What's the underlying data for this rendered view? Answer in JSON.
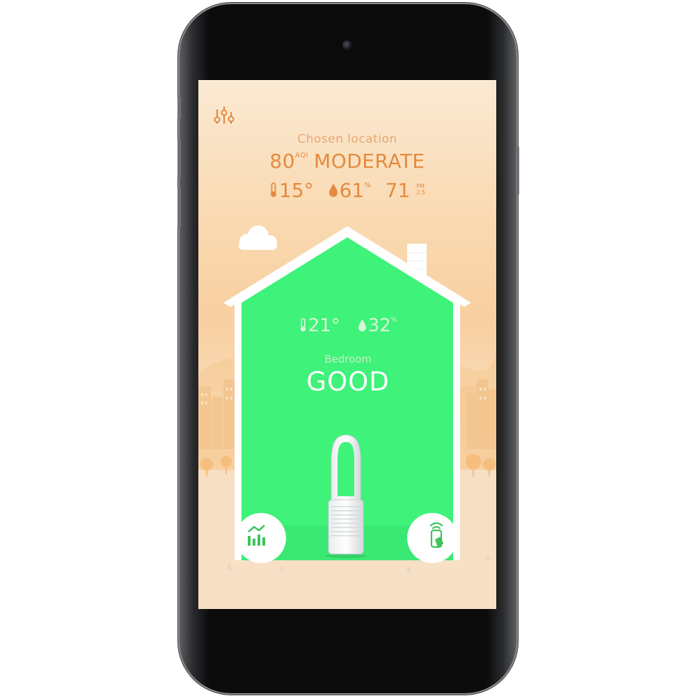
{
  "outdoor": {
    "location_label": "Chosen location",
    "aqi_value": "80",
    "aqi_unit": "AQI",
    "aqi_status": "MODERATE",
    "temperature": "15°",
    "humidity": "61",
    "humidity_unit": "%",
    "pm_value": "71",
    "pm_unit_top": "PM",
    "pm_unit_bottom": "2.5"
  },
  "indoor": {
    "temperature": "21°",
    "humidity": "32",
    "humidity_unit": "%",
    "room_name": "Bedroom",
    "status": "GOOD"
  },
  "icons": {
    "menu": "settings-sliders-icon",
    "history": "chart-history-icon",
    "remote": "remote-control-icon",
    "temperature": "thermometer-icon",
    "humidity": "droplet-icon"
  },
  "colors": {
    "accent": "#e48a3e",
    "house_green": "#3ff27a",
    "sky_peach": "#fadcb6"
  }
}
